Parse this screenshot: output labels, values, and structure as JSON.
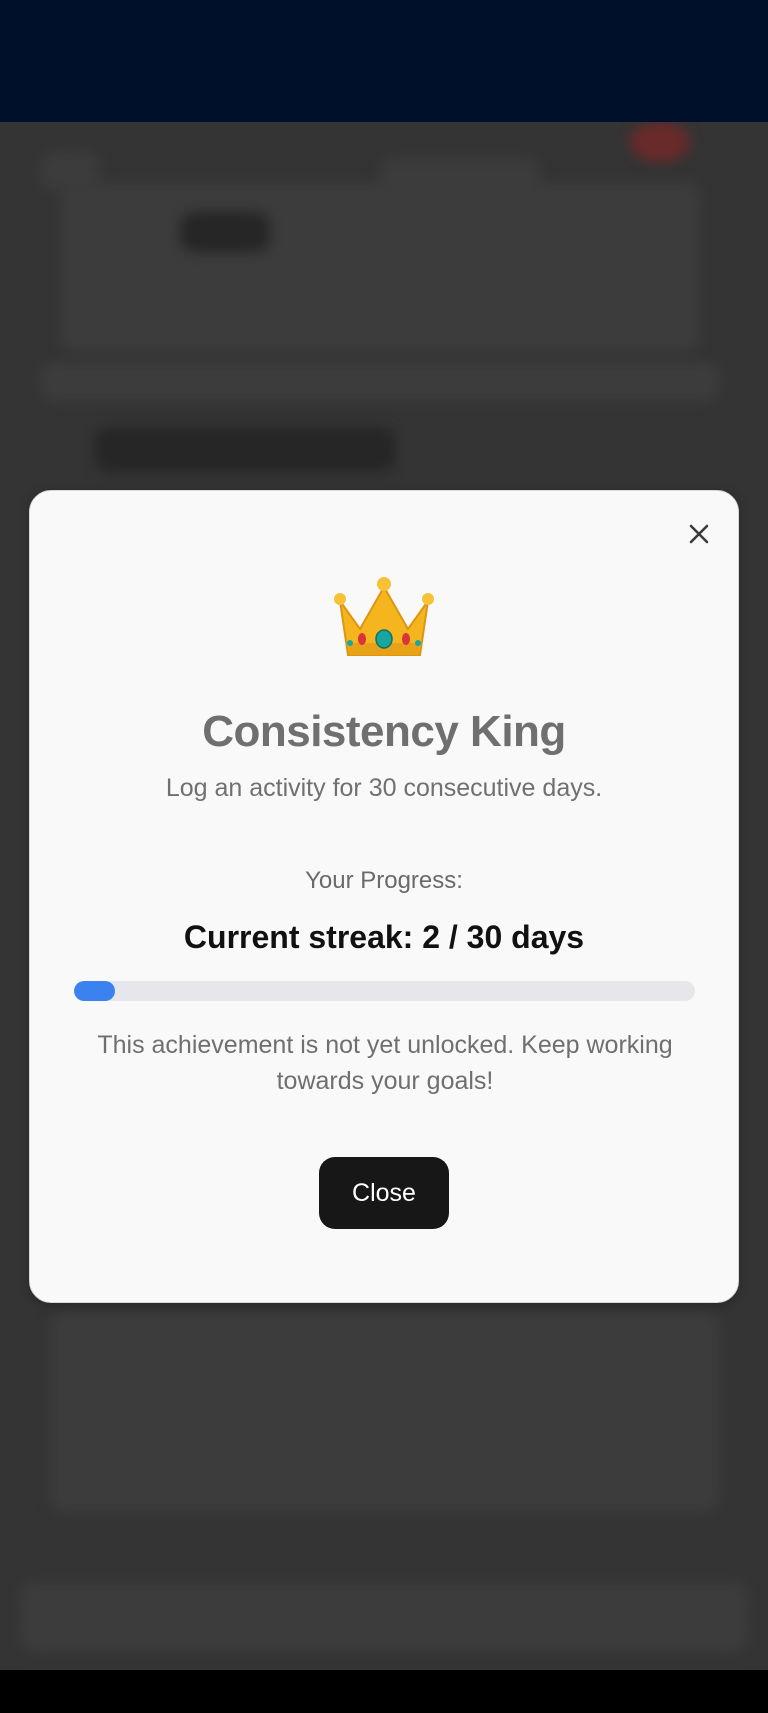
{
  "modal": {
    "emoji": "👑",
    "title": "Consistency King",
    "description": "Log an activity for 30 consecutive days.",
    "progress_label": "Your Progress:",
    "streak_text": "Current streak: 2 / 30 days",
    "progress": {
      "current": 2,
      "target": 30
    },
    "note": "This achievement is not yet unlocked. Keep working towards your goals!",
    "close_button_label": "Close"
  },
  "colors": {
    "progress_fill": "#3b82f0",
    "progress_track": "#e6e7eb",
    "button_bg": "#171717",
    "status_bar": "#00102a",
    "backdrop": "#343434"
  },
  "icons": {
    "close": "close-icon",
    "badge": "crown-icon"
  }
}
